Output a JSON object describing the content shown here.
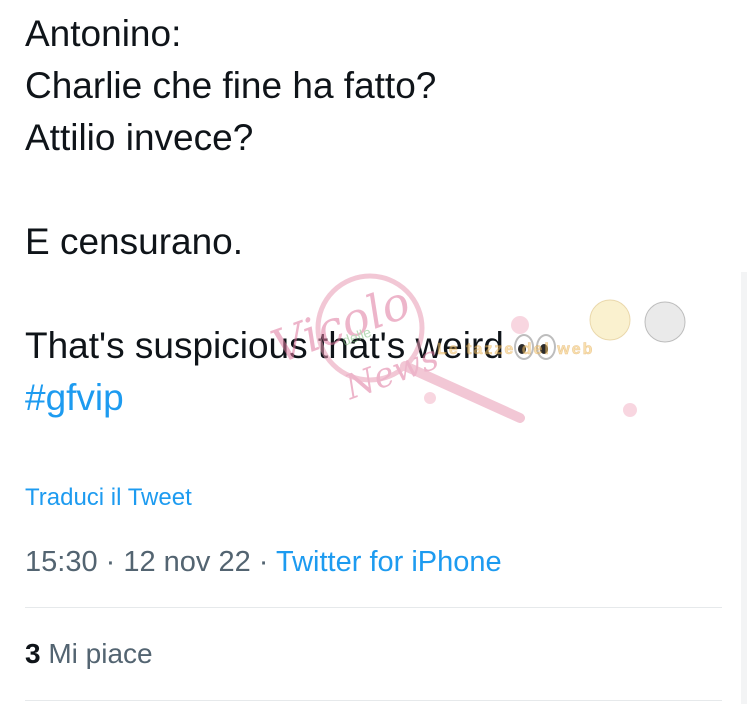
{
  "tweet": {
    "lines": [
      "Antonino:",
      "Charlie che fine ha fatto?",
      "Attilio invece?",
      "",
      "E censurano.",
      "",
      "That's suspicious that's weird"
    ],
    "emoji": "eyes-emoji",
    "hashtag": "#gfvip",
    "translate_label": "Traduci il Tweet",
    "time": "15:30",
    "separator": " · ",
    "date": "12 nov 22",
    "source": "Twitter for iPhone",
    "likes_count": "3",
    "likes_label": "Mi piace"
  },
  "watermark": {
    "text_1": "Vicolo",
    "text_2": "delle",
    "text_3": "News",
    "text_4": "Le tazze del web"
  },
  "colors": {
    "link": "#1d9bf0",
    "text": "#0f1419",
    "muted": "#536471",
    "divider": "#e6e9eb",
    "watermark_pink": "#e89ab3"
  }
}
